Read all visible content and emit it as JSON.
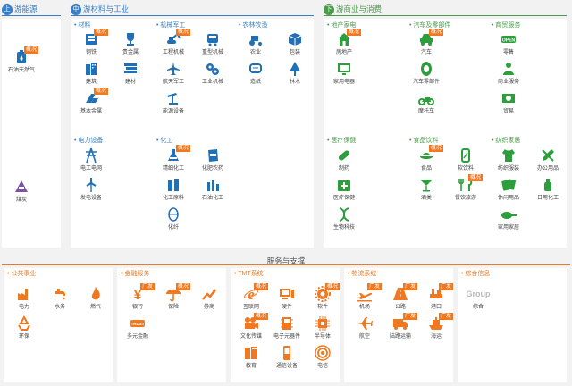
{
  "colors": {
    "upstream": "#3a7fc4",
    "midstream": "#3a7fc4",
    "downstream": "#4a9b4a",
    "service": "#f07820",
    "icon_blue": "#2070b8",
    "icon_green": "#2c9e3c",
    "icon_orange": "#f07820",
    "icon_purple": "#7a52a8",
    "badge": "#f07820"
  },
  "sections": {
    "upstream": {
      "dot": "上",
      "title": "游能源"
    },
    "midstream": {
      "dot": "中",
      "title": "游材料与工业"
    },
    "downstream": {
      "dot": "下",
      "title": "游商业与消费"
    },
    "service": {
      "title": "服务与支撑"
    }
  },
  "upstream_items": [
    {
      "label": "石油天然气",
      "badge": "概况",
      "icon": "oil-gas-icon"
    },
    {
      "label": "煤炭",
      "badge": "",
      "icon": "coal-icon"
    }
  ],
  "categories": {
    "materials": {
      "title": "• 材料",
      "items": [
        {
          "label": "钢铁",
          "badge": "概况",
          "icon": "steel-icon"
        },
        {
          "label": "贵金属",
          "badge": "",
          "icon": "trophy-icon"
        },
        {
          "label": "建筑",
          "badge": "",
          "icon": "building-icon"
        },
        {
          "label": "建材",
          "badge": "",
          "icon": "bricks-icon"
        },
        {
          "label": "基本金属",
          "badge": "概况",
          "icon": "metal-bars-icon"
        }
      ]
    },
    "machinery": {
      "title": "• 机械军工",
      "items": [
        {
          "label": "工程机械",
          "badge": "概况",
          "icon": "excavator-icon"
        },
        {
          "label": "重型机械",
          "badge": "",
          "icon": "train-icon"
        },
        {
          "label": "航天军工",
          "badge": "",
          "icon": "airplane-icon"
        },
        {
          "label": "工业机械",
          "badge": "",
          "icon": "gears-icon"
        },
        {
          "label": "能源设备",
          "badge": "",
          "icon": "oil-pump-icon"
        }
      ]
    },
    "agriculture": {
      "title": "• 农林牧渔",
      "items": [
        {
          "label": "农业",
          "badge": "",
          "icon": "tractor-icon"
        },
        {
          "label": "包装",
          "badge": "",
          "icon": "box-icon"
        },
        {
          "label": "造纸",
          "badge": "",
          "icon": "paper-icon"
        },
        {
          "label": "林木",
          "badge": "",
          "icon": "tree-icon"
        }
      ]
    },
    "power": {
      "title": "• 电力设备",
      "items": [
        {
          "label": "电工电网",
          "badge": "",
          "icon": "power-tower-icon"
        },
        {
          "label": "发电设备",
          "badge": "",
          "icon": "wind-turbine-icon"
        }
      ]
    },
    "chemical": {
      "title": "• 化工",
      "items": [
        {
          "label": "精细化工",
          "badge": "概况",
          "icon": "flask-icon"
        },
        {
          "label": "化肥农药",
          "badge": "",
          "icon": "fertilizer-icon"
        },
        {
          "label": "化工原料",
          "badge": "",
          "icon": "beaker-icon"
        },
        {
          "label": "石油化工",
          "badge": "",
          "icon": "refinery-icon"
        },
        {
          "label": "化纤",
          "badge": "",
          "icon": "fiber-icon"
        }
      ]
    },
    "realestate": {
      "title": "• 地产家电",
      "items": [
        {
          "label": "房地产",
          "badge": "概况",
          "icon": "house-icon"
        },
        {
          "label": "家用电器",
          "badge": "",
          "icon": "appliance-icon"
        }
      ]
    },
    "auto": {
      "title": "• 汽车及零部件",
      "items": [
        {
          "label": "汽车",
          "badge": "概况",
          "icon": "car-icon"
        },
        {
          "label": "汽车零部件",
          "badge": "",
          "icon": "tire-icon"
        },
        {
          "label": "摩托车",
          "badge": "",
          "icon": "motorcycle-icon"
        }
      ]
    },
    "commerce": {
      "title": "• 商贸服务",
      "items": [
        {
          "label": "零售",
          "badge": "",
          "icon": "open-sign-icon"
        },
        {
          "label": "商业服务",
          "badge": "",
          "icon": "service-icon"
        },
        {
          "label": "贸易",
          "badge": "",
          "icon": "money-icon"
        }
      ]
    },
    "health": {
      "title": "• 医疗保健",
      "items": [
        {
          "label": "制药",
          "badge": "",
          "icon": "pill-icon"
        },
        {
          "label": "医疗保健",
          "badge": "",
          "icon": "medkit-icon"
        },
        {
          "label": "生物科技",
          "badge": "",
          "icon": "dna-icon"
        }
      ]
    },
    "food": {
      "title": "• 食品饮料",
      "items": [
        {
          "label": "食品",
          "badge": "概况",
          "icon": "food-icon"
        },
        {
          "label": "软饮料",
          "badge": "",
          "icon": "can-icon"
        },
        {
          "label": "酒类",
          "badge": "",
          "icon": "cocktail-icon"
        },
        {
          "label": "餐饮旅游",
          "badge": "概况",
          "icon": "dining-icon"
        }
      ]
    },
    "textile": {
      "title": "• 纺织家居",
      "items": [
        {
          "label": "纺织服装",
          "badge": "",
          "icon": "tshirt-icon"
        },
        {
          "label": "办公用品",
          "badge": "",
          "icon": "pencil-icon"
        },
        {
          "label": "休闲用品",
          "badge": "",
          "icon": "cards-icon"
        },
        {
          "label": "日用化工",
          "badge": "",
          "icon": "bottle-icon"
        },
        {
          "label": "家用家居",
          "badge": "",
          "icon": "pan-icon"
        }
      ]
    },
    "utility": {
      "title": "• 公共事业",
      "items": [
        {
          "label": "电力",
          "badge": "",
          "icon": "factory-icon"
        },
        {
          "label": "水务",
          "badge": "",
          "icon": "faucet-icon"
        },
        {
          "label": "燃气",
          "badge": "",
          "icon": "gas-flame-icon"
        },
        {
          "label": "环保",
          "badge": "",
          "icon": "recycle-icon"
        }
      ]
    },
    "finance": {
      "title": "• 金融服务",
      "items": [
        {
          "label": "银行",
          "badge": "广发",
          "icon": "yen-icon"
        },
        {
          "label": "保险",
          "badge": "概况",
          "icon": "umbrella-icon"
        },
        {
          "label": "券商",
          "badge": "",
          "icon": "trend-icon"
        },
        {
          "label": "多元金融",
          "badge": "",
          "icon": "trust-icon"
        }
      ]
    },
    "tmt": {
      "title": "• TMT系统",
      "items": [
        {
          "label": "互联网",
          "badge": "概况",
          "icon": "ie-icon"
        },
        {
          "label": "硬件",
          "badge": "",
          "icon": "monitor-icon"
        },
        {
          "label": "软件",
          "badge": "概况",
          "icon": "software-gear-icon"
        },
        {
          "label": "文化传媒",
          "badge": "概况",
          "icon": "camera-icon"
        },
        {
          "label": "电子元器件",
          "badge": "",
          "icon": "chip-board-icon"
        },
        {
          "label": "半导体",
          "badge": "",
          "icon": "cpu-icon"
        },
        {
          "label": "教育",
          "badge": "",
          "icon": "books-icon"
        },
        {
          "label": "通信设备",
          "badge": "",
          "icon": "phone-icon"
        },
        {
          "label": "电信",
          "badge": "",
          "icon": "signal-icon"
        }
      ]
    },
    "logistics": {
      "title": "• 物流系统",
      "items": [
        {
          "label": "机场",
          "badge": "广发",
          "icon": "plane-takeoff-icon"
        },
        {
          "label": "公路",
          "badge": "广发",
          "icon": "road-icon"
        },
        {
          "label": "港口",
          "badge": "广发",
          "icon": "port-icon"
        },
        {
          "label": "航空",
          "badge": "",
          "icon": "plane-icon"
        },
        {
          "label": "陆路运输",
          "badge": "广发",
          "icon": "truck-icon"
        },
        {
          "label": "海运",
          "badge": "广发",
          "icon": "ship-icon"
        }
      ]
    },
    "comprehensive": {
      "title": "• 综合信息",
      "items": [
        {
          "label": "综合",
          "badge": "",
          "icon": "group-icon",
          "text": "Group"
        }
      ]
    }
  }
}
